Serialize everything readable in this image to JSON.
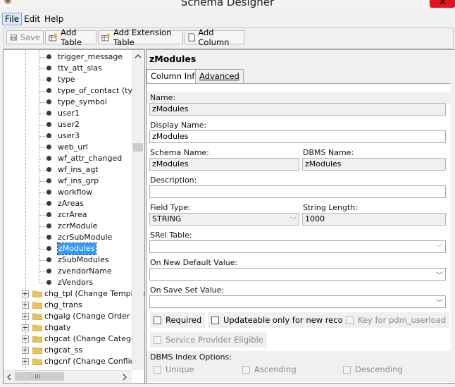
{
  "window": {
    "title": "Schema Designer",
    "close_glyph": "✕"
  },
  "menubar": {
    "items": [
      "File",
      "Edit",
      "Help"
    ]
  },
  "toolbar": {
    "save_label": "Save",
    "add_table_label": "Add Table",
    "add_extension_table_label": "Add Extension Table",
    "add_column_label": "Add Column"
  },
  "tree": {
    "columns": [
      "trigger_message",
      "ttv_att_slas",
      "type",
      "type_of_contact (typ",
      "type_symbol",
      "user1",
      "user2",
      "user3",
      "web_url",
      "wf_attr_changed",
      "wf_ins_agt",
      "wf_ins_grp",
      "workflow",
      "zAreas",
      "zcrArea",
      "zcrModule",
      "zcrSubModule",
      "zModules",
      "zSubModules",
      "zvendorName",
      "zVendors"
    ],
    "selected": "zModules",
    "tables": [
      "chg_tpl (Change Template",
      "chg_trans",
      "chgalg (Change Order Act",
      "chgaty",
      "chgcat (Change Category",
      "chgcat_ss",
      "chgcnf (Change Conflict)"
    ]
  },
  "detail": {
    "title": "zModules",
    "tabs": [
      "Column Info",
      "Advanced"
    ],
    "active_tab": "Column Info",
    "name_label": "Name:",
    "name_value": "zModules",
    "display_name_label": "Display Name:",
    "display_name_value": "zModules",
    "schema_name_label": "Schema Name:",
    "schema_name_value": "zModules",
    "dbms_name_label": "DBMS Name:",
    "dbms_name_value": "zModules",
    "description_label": "Description:",
    "description_value": "",
    "field_type_label": "Field Type:",
    "field_type_value": "STRING",
    "string_length_label": "String Length:",
    "string_length_value": "1000",
    "srel_table_label": "SRel Table:",
    "srel_table_value": "",
    "on_new_default_label": "On New Default Value:",
    "on_new_default_value": "",
    "on_save_set_label": "On Save Set Value:",
    "on_save_set_value": "",
    "required_label": "Required",
    "updateable_label": "Updateable only for new record",
    "key_label": "Key for pdm_userload",
    "service_provider_label": "Service Provider Eligible",
    "dbms_index_label": "DBMS Index Options:",
    "unique_label": "Unique",
    "ascending_label": "Ascending",
    "descending_label": "Descending"
  },
  "colors": {
    "selection": "#3399ff",
    "close": "#e81123",
    "folder": "#e8c25a"
  }
}
